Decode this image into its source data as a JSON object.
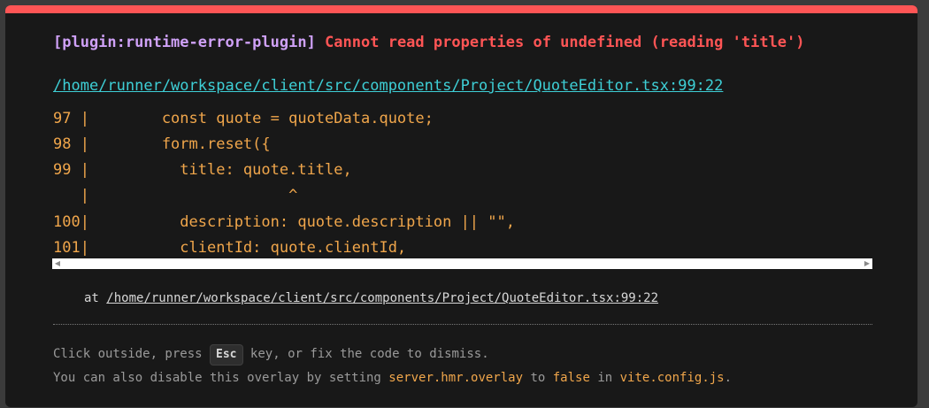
{
  "error": {
    "plugin": "[plugin:runtime-error-plugin]",
    "message": "Cannot read properties of undefined (reading 'title')",
    "file": "/home/runner/workspace/client/src/components/Project/QuoteEditor.tsx:99:22"
  },
  "frame": {
    "lines": [
      "97 |        const quote = quoteData.quote;",
      "98 |        form.reset({",
      "99 |          title: quote.title,",
      "   |                      ^",
      "100|          description: quote.description || \"\",",
      "101|          clientId: quote.clientId,"
    ]
  },
  "stack": {
    "at": "at",
    "location": "/home/runner/workspace/client/src/components/Project/QuoteEditor.tsx:99:22"
  },
  "tip": {
    "line1_pre": "Click outside, press ",
    "key": "Esc",
    "line1_post": " key, or fix the code to dismiss.",
    "line2_a": "You can also disable this overlay by setting ",
    "line2_code1": "server.hmr.overlay",
    "line2_b": " to ",
    "line2_code2": "false",
    "line2_c": " in ",
    "line2_code3": "vite.config.js",
    "line2_d": "."
  },
  "colors": {
    "accent_red": "#ff5555",
    "plugin_purple": "#cfa1f7",
    "link_cyan": "#3ecfd6",
    "code_orange": "#f0a64b"
  },
  "icons": {
    "scroll_left": "scroll-left-arrow-icon",
    "scroll_right": "scroll-right-arrow-icon"
  }
}
